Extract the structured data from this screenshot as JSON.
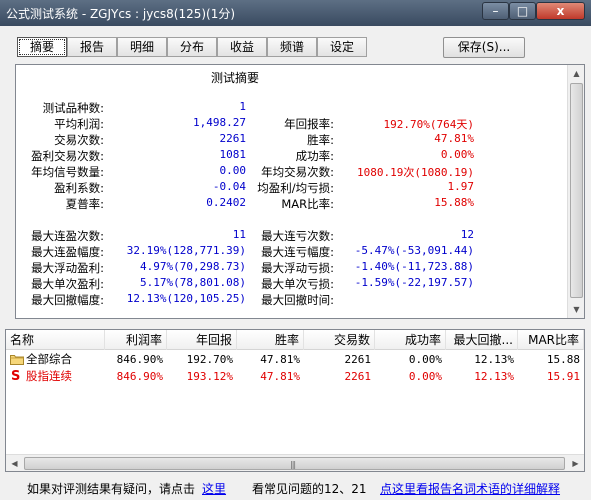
{
  "window": {
    "title": "公式测试系统 - ZGJYcs : jycs8(125)(1分)",
    "min_label": "–",
    "max_label": "□",
    "close_label": "x"
  },
  "tabs": [
    {
      "label": "摘要",
      "active": true
    },
    {
      "label": "报告"
    },
    {
      "label": "明细"
    },
    {
      "label": "分布"
    },
    {
      "label": "收益"
    },
    {
      "label": "频谱"
    },
    {
      "label": "设定"
    }
  ],
  "save_label": "保存(S)...",
  "summary": {
    "title": "测试摘要",
    "left": [
      {
        "label": "测试品种数:",
        "value": "1"
      },
      {
        "label": "平均利润:",
        "value": "1,498.27"
      },
      {
        "label": "交易次数:",
        "value": "2261"
      },
      {
        "label": "盈利交易次数:",
        "value": "1081"
      },
      {
        "label": "年均信号数量:",
        "value": "0.00"
      },
      {
        "label": "盈利系数:",
        "value": "-0.04"
      },
      {
        "label": "夏普率:",
        "value": "0.2402"
      },
      {
        "label": "最大连盈次数:",
        "value": "11"
      },
      {
        "label": "最大连盈幅度:",
        "value": "32.19%(128,771.39)"
      },
      {
        "label": "最大浮动盈利:",
        "value": "4.97%(70,298.73)"
      },
      {
        "label": "最大单次盈利:",
        "value": "5.17%(78,801.08)"
      },
      {
        "label": "最大回撤幅度:",
        "value": "12.13%(120,105.25)"
      }
    ],
    "right": [
      {
        "label": "年回报率:",
        "value": "192.70%(764天)"
      },
      {
        "label": "胜率:",
        "value": "47.81%"
      },
      {
        "label": "成功率:",
        "value": "0.00%"
      },
      {
        "label": "年均交易次数:",
        "value": "1080.19次(1080.19)"
      },
      {
        "label": "均盈利/均亏损:",
        "value": "1.97"
      },
      {
        "label": "MAR比率:",
        "value": "15.88%"
      },
      {
        "label": "最大连亏次数:",
        "value": "12"
      },
      {
        "label": "最大连亏幅度:",
        "value": "-5.47%(-53,091.44)"
      },
      {
        "label": "最大浮动亏损:",
        "value": "-1.40%(-11,723.88)"
      },
      {
        "label": "最大单次亏损:",
        "value": "-1.59%(-22,197.57)"
      },
      {
        "label": "最大回撤时间:",
        "value": ""
      }
    ]
  },
  "table": {
    "headers": [
      "名称",
      "利润率",
      "年回报",
      "胜率",
      "交易数",
      "成功率",
      "最大回撤...",
      "MAR比率"
    ],
    "rows": [
      {
        "icon": "folder-icon",
        "cells": [
          "全部综合",
          "846.90%",
          "192.70%",
          "47.81%",
          "2261",
          "0.00%",
          "12.13%",
          "15.88"
        ],
        "color": "#000000"
      },
      {
        "icon": "s-icon",
        "icon_text": "S",
        "cells": [
          "股指连续",
          "846.90%",
          "193.12%",
          "47.81%",
          "2261",
          "0.00%",
          "12.13%",
          "15.91"
        ],
        "color": "#e00000"
      }
    ]
  },
  "footer": {
    "question_text": "如果对评测结果有疑问，请点击",
    "here_link": "这里",
    "faq_text": "看常见问题的12、21",
    "glossary_link": "点这里看报告名词术语的详细解释"
  },
  "colors": {
    "positive": "#0000cc",
    "negative": "#e00000",
    "titlebar": "#394a60"
  }
}
